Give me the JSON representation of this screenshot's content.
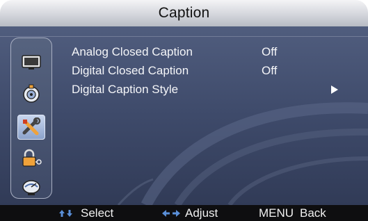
{
  "title": "Caption",
  "sidebar": {
    "items": [
      {
        "icon": "picture-icon"
      },
      {
        "icon": "sound-icon"
      },
      {
        "icon": "setup-icon",
        "selected": true
      },
      {
        "icon": "lock-icon"
      },
      {
        "icon": "channel-icon"
      }
    ]
  },
  "menu": {
    "items": [
      {
        "label": "Analog Closed Caption",
        "value": "Off"
      },
      {
        "label": "Digital Closed Caption",
        "value": "Off"
      },
      {
        "label": "Digital Caption Style",
        "value": "",
        "submenu": true
      }
    ]
  },
  "footer": {
    "select": {
      "icon": "up-down-arrows-icon",
      "label": "Select"
    },
    "adjust": {
      "icon": "left-right-arrows-icon",
      "label": "Adjust"
    },
    "back": {
      "key": "MENU",
      "label": "Back"
    }
  },
  "colors": {
    "selected_icon_bg": "#a9bde0",
    "accent_orange": "#f0a23a"
  }
}
